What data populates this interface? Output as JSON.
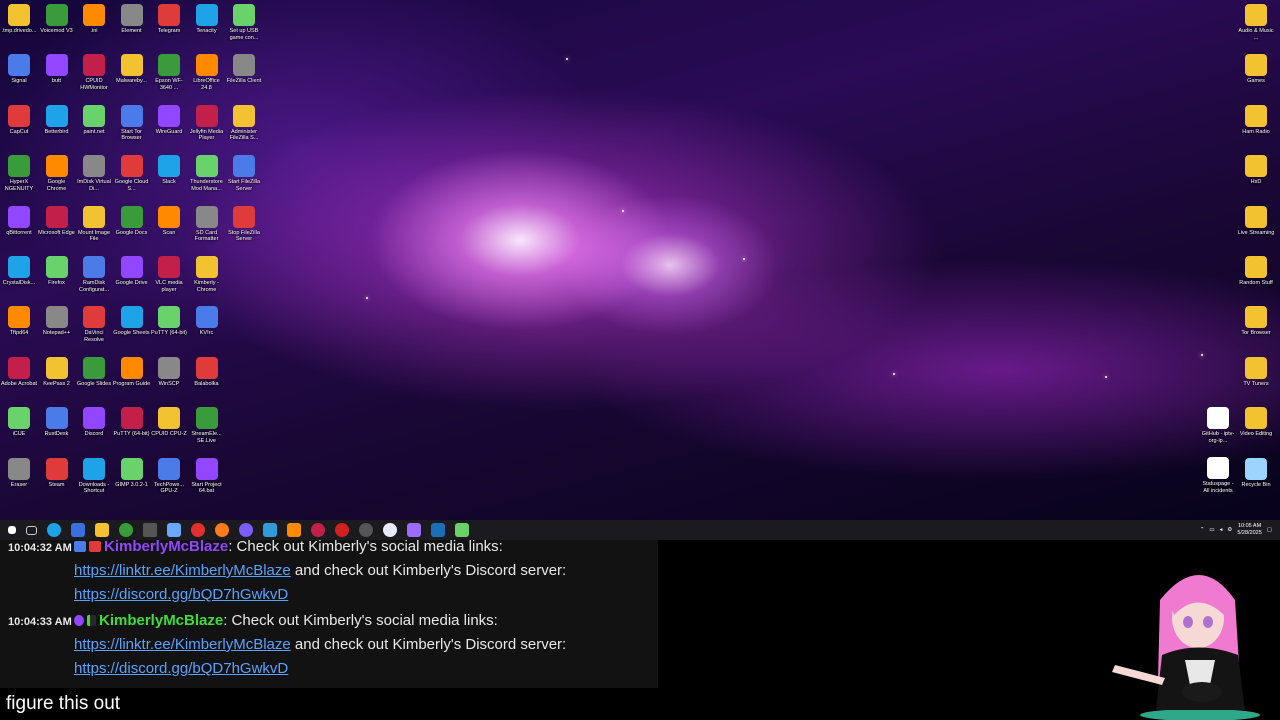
{
  "desktop": {
    "left_icons": [
      [
        ".tmp.drivedo...",
        "Signal",
        "CapCut",
        "HyperX NGENUITY",
        "qBittorrent",
        "CrystalDisk...",
        "Tftpd64",
        "Adobe Acrobat",
        "iCUE",
        "Eraser"
      ],
      [
        "Voicemod V3",
        "butt",
        "Betterbird",
        "Google Chrome",
        "Microsoft Edge",
        "Firefox",
        "Notepad++",
        "KeePass 2",
        "RustDesk",
        "Steam"
      ],
      [
        ".ini",
        "CPUID HWMonitor",
        "paint.net",
        "ImDisk Virtual Di...",
        "Mount Image File",
        "RamDisk Configurat...",
        "DaVinci Resolve",
        "Google Slides",
        "Discord",
        "Downloads - Shortcut"
      ],
      [
        "Element",
        "Malwareby...",
        "Start Tor Browser",
        "Google Cloud S...",
        "Google Docs",
        "Google Drive",
        "Google Sheets",
        "Program Guide",
        "PuTTY (64-bit)",
        "GIMP 3.0.2-1"
      ],
      [
        "Telegram",
        "Epson WF-3640 ...",
        "WireGuard",
        "Slack",
        "Scan",
        "VLC media player",
        "PuTTY (64-bit)",
        "WinSCP",
        "CPUID CPU-Z",
        "TechPowe... GPU-Z"
      ],
      [
        "Tenacity",
        "LibreOffice 24.8",
        "Jellyfin Media Player",
        "Thunderstore Mod Mana...",
        "SD Card Formatter",
        "Kimberly - Chrome",
        "KVIrc",
        "Balabolka",
        "StreamEle... SE.Live",
        "Start Project 64.bat"
      ],
      [
        "Set up USB game con...",
        "FileZilla Client",
        "Administer FileZilla S...",
        "Start FileZilla Server",
        "Stop FileZilla Server"
      ]
    ],
    "right_icons": [
      "Audio & Music ...",
      "Games",
      "Ham Radio",
      "HxD",
      "Live Streaming",
      "Random Stuff",
      "Tor Browser",
      "TV Tuners",
      "Video Editing",
      "Recycle Bin"
    ],
    "right_icons_col2": [
      "GitHub - iptv-org-ip...",
      "Statuspage - All incidents"
    ]
  },
  "taskbar": {
    "clock_time": "10:05 AM",
    "clock_date": "5/28/2025"
  },
  "chat": {
    "messages": [
      {
        "time": "10:04:32 AM",
        "username": "KimberlyMcBlaze",
        "text_a": ": Check out Kimberly's social media links:",
        "link1": "https://linktr.ee/KimberlyMcBlaze",
        "text_b": " and check out Kimberly's Discord server:",
        "link2": "https://discord.gg/bQD7hGwkvD"
      },
      {
        "time": "10:04:33 AM",
        "username": "KimberlyMcBlaze",
        "text_a": ": Check out Kimberly's social media links:",
        "link1": "https://linktr.ee/KimberlyMcBlaze",
        "text_b": " and check out Kimberly's Discord server:",
        "link2": "https://discord.gg/bQD7hGwkvD"
      }
    ]
  },
  "caption": "figure this out",
  "colors": {
    "username_purple": "#9146ff",
    "username_green": "#3ddc3d",
    "link": "#5aa2ff"
  }
}
